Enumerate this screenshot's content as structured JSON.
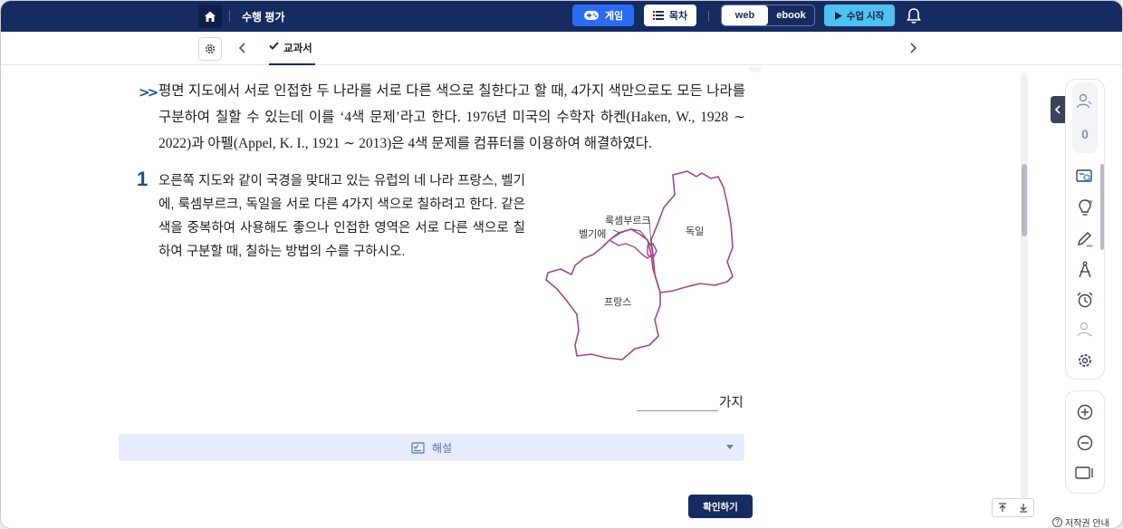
{
  "topbar": {
    "title": "수행 평가",
    "game_label": "게임",
    "toc_label": "목차",
    "mode_web": "web",
    "mode_ebook": "ebook",
    "start_label": "수업 시작"
  },
  "subbar": {
    "tab_label": "교과서"
  },
  "content": {
    "intro": "평면 지도에서 서로 인접한 두 나라를 서로 다른 색으로 칠한다고 할 때, 4가지 색만으로도 모든 나라를 구분하여 칠할 수 있는데 이를 ‘4색 문제’라고 한다. 1976년 미국의 수학자 하켄(Haken, W., 1928 ∼ 2022)과 아펠(Appel, K. I., 1921 ∼ 2013)은 4색 문제를 컴퓨터를 이용하여 해결하였다.",
    "question_number": "1",
    "question_text": "오른쪽 지도와 같이 국경을 맞대고 있는 유럽의 네 나라 프랑스, 벨기에, 룩셈부르크, 독일을 서로 다른 4가지 색으로 칠하려고 한다. 같은 색을 중복하여 사용해도 좋으나 인접한 영역은 서로 다른 색으로 칠하여 구분할 때, 칠하는 방법의 수를 구하시오.",
    "map_labels": {
      "luxembourg": "룩셈부르크",
      "belgium": "벨기에",
      "germany": "독일",
      "france": "프랑스"
    },
    "answer_unit": "가지",
    "solution_label": "해설",
    "confirm_label": "확인하기"
  },
  "toolbar": {
    "user_count": "0"
  },
  "footer": {
    "copyright_label": "저작권 안내"
  },
  "colors": {
    "navy": "#162b5f",
    "game_blue": "#2d6bf2",
    "start_cyan": "#4fc0ef",
    "accent_blue": "#1a4f8a",
    "map_border": "#a0468c",
    "solution_bg": "#e6ecfb"
  }
}
